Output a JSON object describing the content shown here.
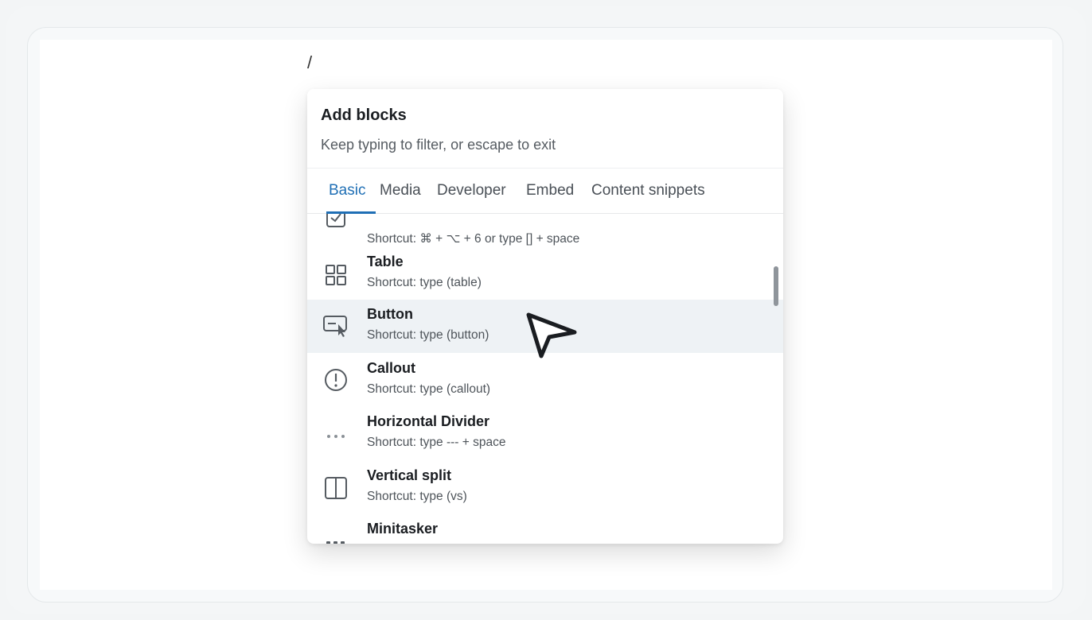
{
  "editor": {
    "slash_text": "/"
  },
  "menu": {
    "title": "Add blocks",
    "subtitle": "Keep typing to filter, or escape to exit",
    "tabs": [
      {
        "label": "Basic",
        "active": true
      },
      {
        "label": "Media"
      },
      {
        "label": "Developer"
      },
      {
        "label": "Embed"
      },
      {
        "label": "Content snippets"
      }
    ],
    "items": [
      {
        "title": "",
        "shortcut": "Shortcut: ⌘ + ⌥ + 6 or type [] + space",
        "icon": "checkbox-icon"
      },
      {
        "title": "Table",
        "shortcut": "Shortcut: type (table)",
        "icon": "table-icon"
      },
      {
        "title": "Button",
        "shortcut": "Shortcut: type (button)",
        "icon": "button-icon",
        "highlighted": true
      },
      {
        "title": "Callout",
        "shortcut": "Shortcut: type (callout)",
        "icon": "callout-icon"
      },
      {
        "title": "Horizontal Divider",
        "shortcut": "Shortcut: type --- + space",
        "icon": "divider-icon"
      },
      {
        "title": "Vertical split",
        "shortcut": "Shortcut: type (vs)",
        "icon": "vertical-split-icon"
      },
      {
        "title": "Minitasker",
        "shortcut": "",
        "icon": "minitasker-icon"
      }
    ]
  },
  "colors": {
    "accent": "#1f6fb5",
    "highlight_row": "#eef2f5"
  }
}
